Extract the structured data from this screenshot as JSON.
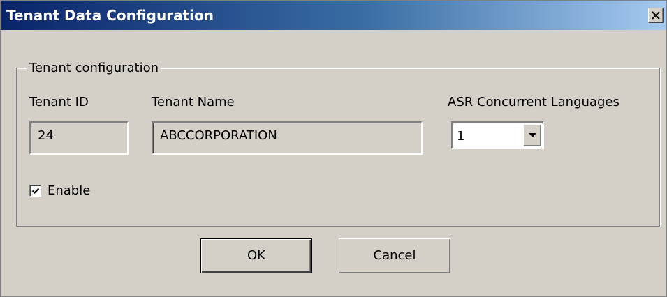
{
  "window": {
    "title": "Tenant Data Configuration",
    "close_glyph": "close-icon"
  },
  "group": {
    "legend": "Tenant configuration",
    "tenant_id_label": "Tenant ID",
    "tenant_id_value": "24",
    "tenant_name_label": "Tenant Name",
    "tenant_name_value": "ABCCORPORATION",
    "asr_label": "ASR Concurrent Languages",
    "asr_selected": "1",
    "enable_label": "Enable",
    "enable_checked": true
  },
  "buttons": {
    "ok_label": "OK",
    "cancel_label": "Cancel"
  },
  "colors": {
    "title_gradient_start": "#0a246a",
    "title_gradient_end": "#a6caf0",
    "face": "#d4d0c8"
  }
}
